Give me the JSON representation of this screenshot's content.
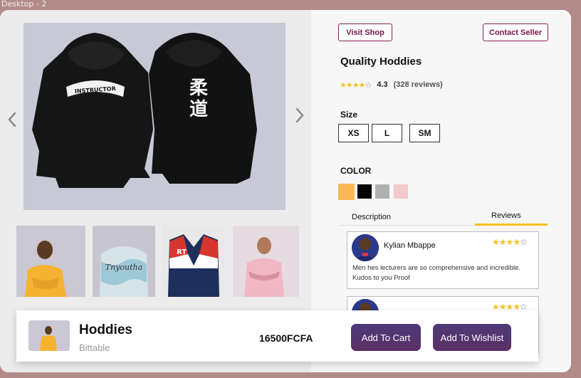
{
  "frame": {
    "label": "Desktop - 2"
  },
  "header_actions": {
    "visit_shop": "Visit Shop",
    "contact_seller": "Contact Seller"
  },
  "product": {
    "title": "Quality Hoddies",
    "rating": 4.3,
    "rating_text": "4.3",
    "reviews_count": "(328 reviews)",
    "stars_filled": 4,
    "stars_total": 5,
    "hoodie_patch_text": "INSTRUCTOR",
    "hoodie_back_text": "柔道"
  },
  "size": {
    "label": "Size",
    "options": [
      "XS",
      "L",
      "SM"
    ]
  },
  "color": {
    "label": "COLOR",
    "swatches": [
      "#fbb756",
      "#050505",
      "#b0b0b0",
      "#f3c9c9"
    ]
  },
  "tabs": {
    "description": "Description",
    "reviews": "Reviews",
    "active": "Reviews"
  },
  "reviews": [
    {
      "name": "Kylian Mbappe",
      "stars": 4,
      "text": "Men hes lecturers are so comprehensive and incredible. Kudos to you Proof"
    },
    {
      "name": "",
      "stars": 4,
      "text": ""
    }
  ],
  "bottom_bar": {
    "title": "Hoddies",
    "subtitle": "Bittable",
    "price": "16500FCFA",
    "add_to_cart": "Add To Cart",
    "add_to_wishlist": "Add To Wishlist"
  },
  "icons": {
    "prev": "chevron-left-icon",
    "next": "chevron-right-icon",
    "star": "star-icon"
  },
  "colors": {
    "accent": "#7a1446",
    "star": "#f4c324",
    "cta_gradient_start": "#4d3a7a",
    "cta_gradient_end": "#5b2f63",
    "background": "#b28a8a"
  }
}
